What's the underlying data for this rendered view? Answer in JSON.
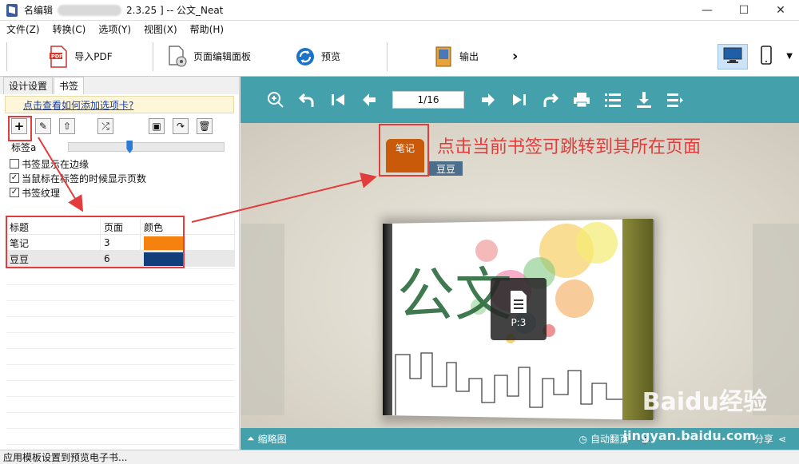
{
  "window": {
    "title_prefix": "名编辑",
    "title_suffix": "2.3.25 ] -- 公文_Neat",
    "minimize": "—",
    "maximize": "☐",
    "close": "✕"
  },
  "menu": [
    "文件(Z)",
    "转换(C)",
    "选项(Y)",
    "视图(X)",
    "帮助(H)"
  ],
  "toolbar": {
    "import_pdf": "导入PDF",
    "page_editor": "页面编辑面板",
    "preview": "预览",
    "output": "输出",
    "more": "›"
  },
  "left_panel": {
    "tabs": [
      "设计设置",
      "书签"
    ],
    "active_tab": 1,
    "hint_link": "点击查看如何添加选项卡?",
    "slider_label": "标签a",
    "slider_value": 0.4,
    "options": [
      {
        "label": "书签显示在边缘",
        "checked": false
      },
      {
        "label": "当鼠标在标签的时候显示页数",
        "checked": true
      },
      {
        "label": "书签纹理",
        "checked": true
      }
    ],
    "table": {
      "headers": [
        "标题",
        "页面",
        "颜色"
      ],
      "rows": [
        {
          "title": "笔记",
          "page": "3",
          "color": "#f5820f"
        },
        {
          "title": "豆豆",
          "page": "6",
          "color": "#133e7c"
        }
      ]
    }
  },
  "preview": {
    "page_indicator": "1/16",
    "bookmark_tabs": [
      {
        "label": "笔记",
        "color": "#c85a0a"
      },
      {
        "label": "豆豆",
        "color": "#4b6f8a"
      }
    ],
    "page_bubble": "P:3",
    "bottom": {
      "thumbnails": "缩略图",
      "auto_flip": "自动翻页",
      "share": "分享"
    }
  },
  "annotation": "点击当前书签可跳转到其所在页面",
  "status": "应用模板设置到预览电子书...",
  "watermark": {
    "brand": "Baidu经验",
    "url": "jingyan.baidu.com"
  }
}
